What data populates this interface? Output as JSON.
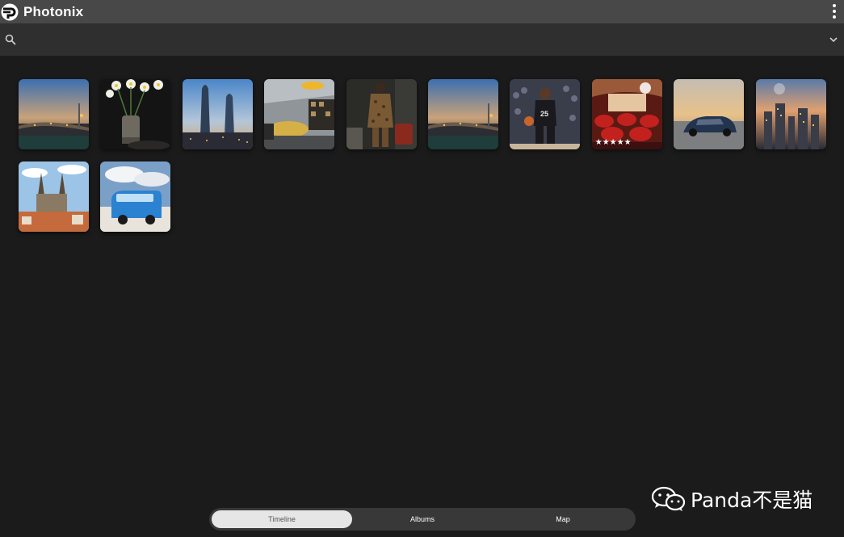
{
  "app": {
    "title": "Photonix"
  },
  "search": {
    "value": "",
    "placeholder": ""
  },
  "photos": [
    {
      "subject": "bridge at sunset",
      "rating": 0
    },
    {
      "subject": "white daffodils in vase",
      "rating": 0
    },
    {
      "subject": "twin towers at dusk",
      "rating": 0
    },
    {
      "subject": "modern office lounge",
      "rating": 0
    },
    {
      "subject": "fashion model in patterned coat",
      "rating": 0
    },
    {
      "subject": "bridge at sunset",
      "rating": 0
    },
    {
      "subject": "basketball player",
      "rating": 0
    },
    {
      "subject": "red theater room",
      "rating": 5,
      "stars": "★★★★★"
    },
    {
      "subject": "blue sedan at sunset",
      "rating": 0
    },
    {
      "subject": "city skyline at dusk",
      "rating": 0
    },
    {
      "subject": "gothic church old town",
      "rating": 0
    },
    {
      "subject": "blue camper van on beach",
      "rating": 0
    }
  ],
  "nav": {
    "tabs": [
      {
        "label": "Timeline",
        "active": true
      },
      {
        "label": "Albums",
        "active": false
      },
      {
        "label": "Map",
        "active": false
      }
    ]
  },
  "watermark": {
    "text": "Panda不是猫"
  },
  "colors": {
    "header_bg": "#484848",
    "search_bg": "#2f2f2f",
    "page_bg": "#1b1b1b",
    "nav_bg": "#383838",
    "nav_active": "#e6e6e6"
  }
}
